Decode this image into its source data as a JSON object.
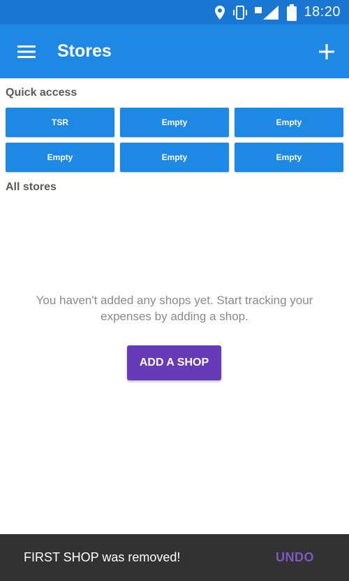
{
  "status_bar": {
    "time": "18:20",
    "icons": [
      "location-icon",
      "vibrate-icon",
      "signal-icon",
      "battery-icon"
    ]
  },
  "app_bar": {
    "title": "Stores",
    "menu_icon": "hamburger-menu-icon",
    "add_icon": "plus-icon"
  },
  "quick_access": {
    "label": "Quick access",
    "tiles": [
      "TSR",
      "Empty",
      "Empty",
      "Empty",
      "Empty",
      "Empty"
    ]
  },
  "all_stores": {
    "label": "All stores",
    "empty_message": "You haven't added any shops yet. Start tracking your expenses by adding a shop.",
    "add_button_label": "ADD A SHOP"
  },
  "snackbar": {
    "message": "FIRST SHOP was removed!",
    "action_label": "UNDO"
  },
  "colors": {
    "status_bar": "#1976D2",
    "primary": "#1E88E5",
    "accent": "#673AB7",
    "snackbar_bg": "#323232",
    "snackbar_action": "#7E57C2"
  }
}
